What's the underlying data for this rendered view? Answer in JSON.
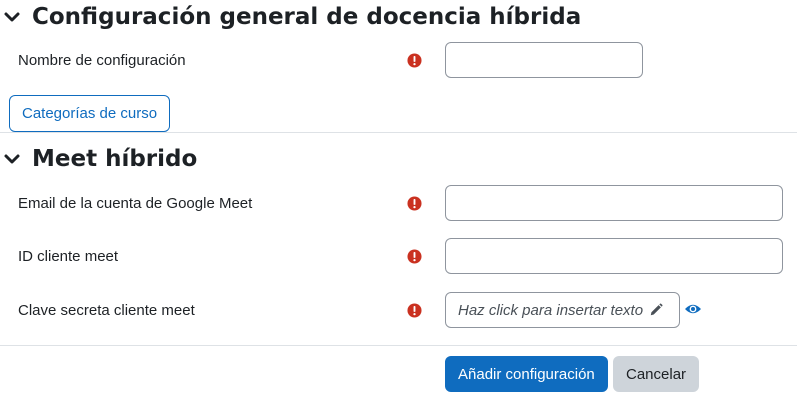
{
  "colors": {
    "primary": "#0f6cbf",
    "required_icon": "#ca3120",
    "secondary_button": "#ced4da",
    "text": "#1d2125",
    "input_border": "#8f959e",
    "divider": "#dee2e6"
  },
  "section_general": {
    "icon": "chevron-down-icon",
    "title": "Configuración general de docencia híbrida",
    "fields": {
      "config_name": {
        "label": "Nombre de configuración",
        "value": "",
        "required_icon": "required-icon"
      }
    },
    "categories_button": "Categorías de curso"
  },
  "section_meet": {
    "icon": "chevron-down-icon",
    "title": "Meet híbrido",
    "fields": {
      "email": {
        "label": "Email de la cuenta de Google Meet",
        "value": "",
        "required_icon": "required-icon"
      },
      "client_id": {
        "label": "ID cliente meet",
        "value": "",
        "required_icon": "required-icon"
      },
      "client_secret": {
        "label": "Clave secreta cliente meet",
        "placeholder": "Haz click para insertar texto",
        "edit_icon": "pencil-icon",
        "reveal_icon": "eye-icon",
        "required_icon": "required-icon"
      }
    }
  },
  "actions": {
    "submit": "Añadir configuración",
    "cancel": "Cancelar"
  }
}
